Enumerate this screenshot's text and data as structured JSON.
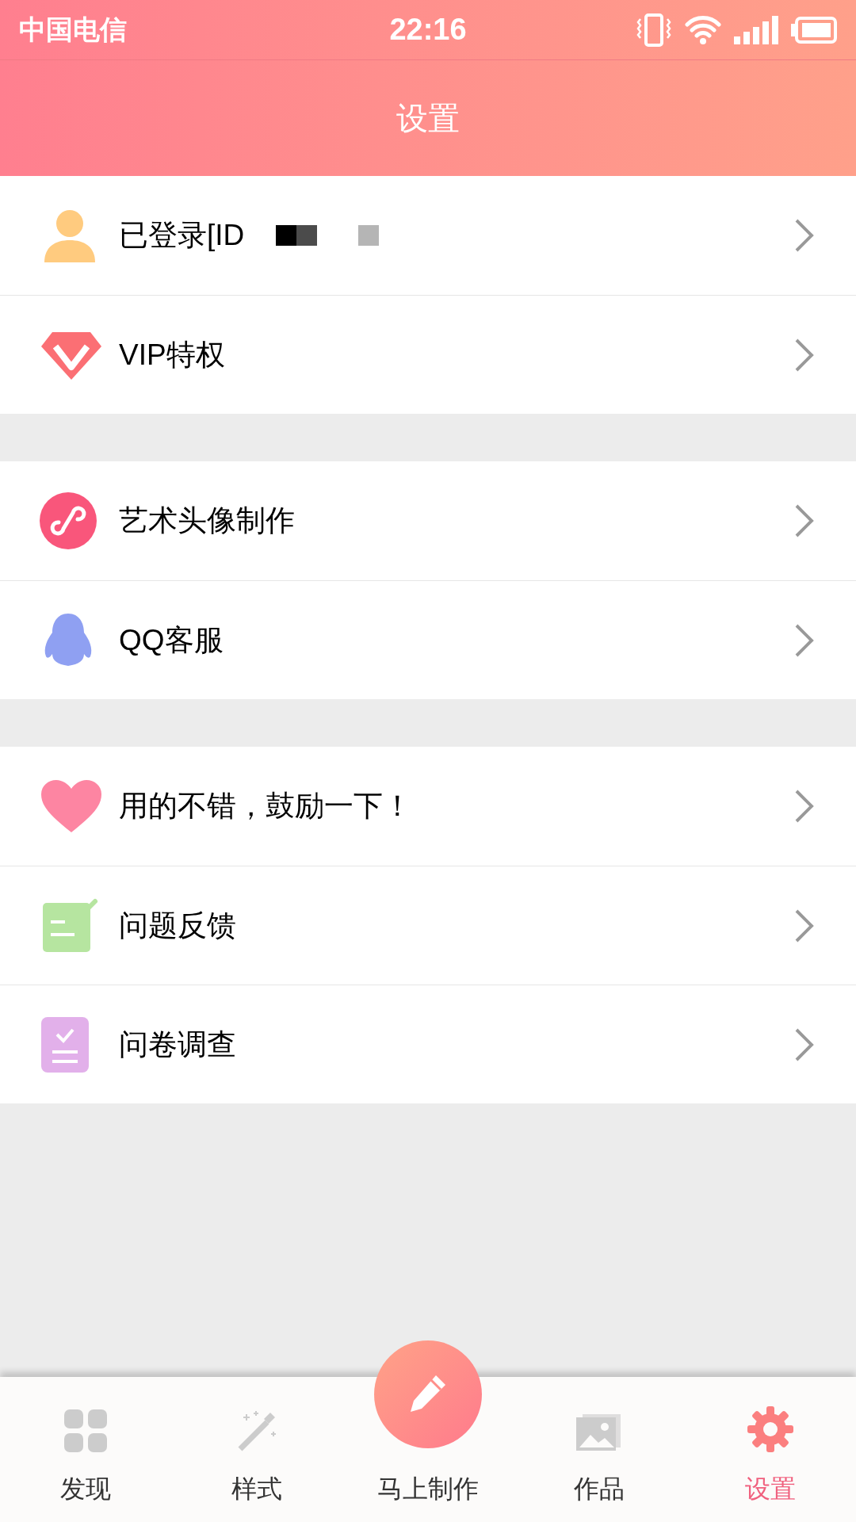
{
  "status_bar": {
    "carrier": "中国电信",
    "time": "22:16"
  },
  "header": {
    "title": "设置"
  },
  "groups": [
    {
      "items": [
        {
          "kind": "account",
          "label": "已登录[ID",
          "redacted": true
        },
        {
          "kind": "vip",
          "label": "VIP特权"
        }
      ]
    },
    {
      "items": [
        {
          "kind": "link",
          "label": "艺术头像制作"
        },
        {
          "kind": "qq",
          "label": "QQ客服"
        }
      ]
    },
    {
      "items": [
        {
          "kind": "heart",
          "label": "用的不错，鼓励一下！"
        },
        {
          "kind": "feedback",
          "label": "问题反馈"
        },
        {
          "kind": "survey",
          "label": "问卷调查"
        }
      ]
    }
  ],
  "tab_bar": [
    {
      "kind": "grid",
      "label": "发现",
      "selected": false
    },
    {
      "kind": "wand",
      "label": "样式",
      "selected": false
    },
    {
      "kind": "create",
      "label": "马上制作",
      "selected": false
    },
    {
      "kind": "photos",
      "label": "作品",
      "selected": false
    },
    {
      "kind": "gear",
      "label": "设置",
      "selected": true
    }
  ]
}
